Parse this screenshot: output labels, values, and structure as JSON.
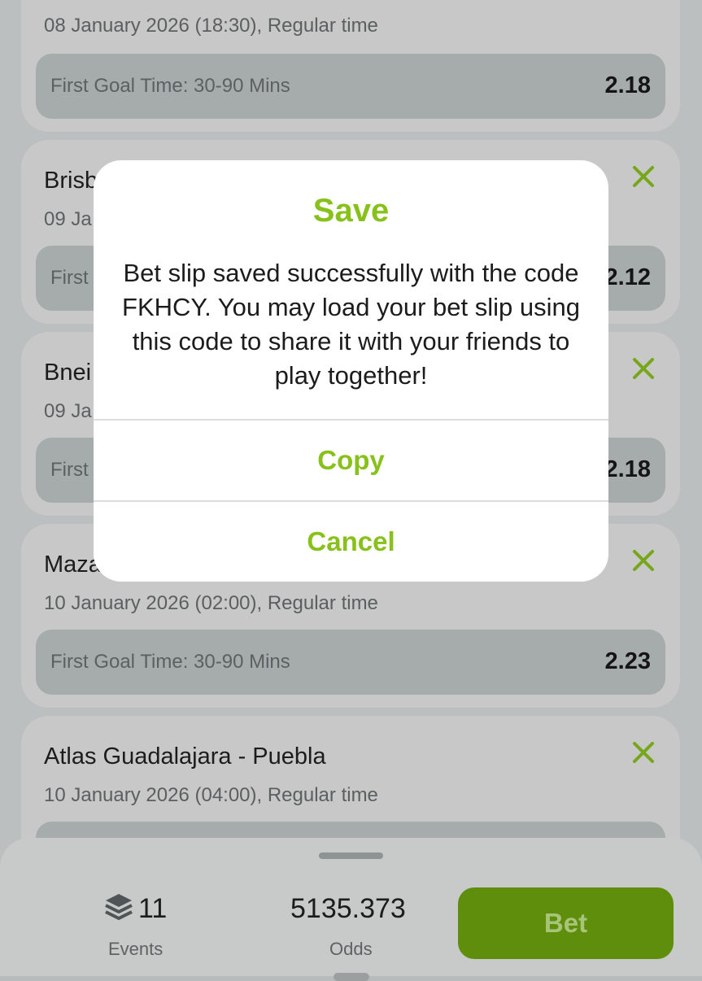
{
  "cards": [
    {
      "title": "",
      "meta": "08 January 2026 (18:30), Regular time",
      "market": "First Goal Time: 30-90 Mins",
      "odds": "2.18"
    },
    {
      "title": "Brisb",
      "meta": "09 Ja",
      "market": "First",
      "odds": "2.12"
    },
    {
      "title": "Bnei",
      "meta": "09 Ja",
      "market": "First",
      "odds": "2.18"
    },
    {
      "title": "Maza",
      "meta": "10 January 2026 (02:00), Regular time",
      "market": "First Goal Time: 30-90 Mins",
      "odds": "2.23"
    },
    {
      "title": "Atlas Guadalajara - Puebla",
      "meta": "10 January 2026 (04:00), Regular time",
      "market": "",
      "odds": ""
    }
  ],
  "modal": {
    "title": "Save",
    "message": "Bet slip saved successfully with the code FKHCY. You may load your bet slip using this code to share it with your friends to play together!",
    "copy_label": "Copy",
    "cancel_label": "Cancel"
  },
  "summary": {
    "events_count": "11",
    "events_label": "Events",
    "odds_value": "5135.373",
    "odds_label": "Odds",
    "bet_label": "Bet"
  },
  "icons": {
    "remove": "close-x-icon",
    "events": "layers-icon"
  },
  "colors": {
    "accent_green": "#88c11c",
    "bet_button": "#5f8e0d",
    "overlay": "#bcbfbf"
  }
}
